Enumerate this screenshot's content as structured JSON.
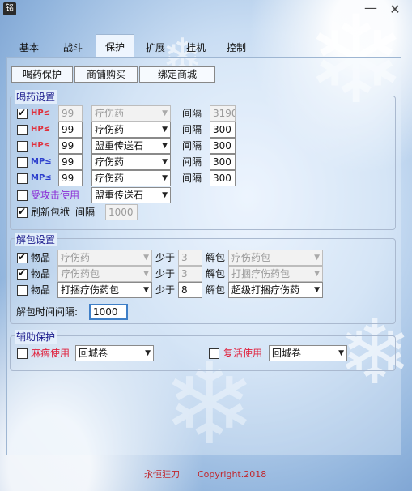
{
  "window": {
    "app_icon": "铭",
    "minimize_icon": "minimize-icon",
    "close_icon": "close-icon",
    "minimize_label": "—",
    "close_label": "✕"
  },
  "main_tabs": [
    "基本",
    "战斗",
    "保护",
    "扩展",
    "挂机",
    "控制"
  ],
  "active_main_tab": "保护",
  "sub_tabs": [
    "喝药保护",
    "商铺购买",
    "绑定商城"
  ],
  "potion_group": {
    "title": "喝药设置",
    "interval_label": "间隔",
    "rows": [
      {
        "checked": true,
        "tag": "HP≤",
        "percent": "99",
        "item": "疗伤药",
        "interval": "3190",
        "enabled": false
      },
      {
        "checked": false,
        "tag": "HP≤",
        "percent": "99",
        "item": "疗伤药",
        "interval": "300",
        "enabled": true
      },
      {
        "checked": false,
        "tag": "HP≤",
        "percent": "99",
        "item": "盟重传送石",
        "interval": "300",
        "enabled": true
      },
      {
        "checked": false,
        "tag": "MP≤",
        "percent": "99",
        "item": "疗伤药",
        "interval": "300",
        "enabled": true
      },
      {
        "checked": false,
        "tag": "MP≤",
        "percent": "99",
        "item": "疗伤药",
        "interval": "300",
        "enabled": true
      }
    ],
    "attacked": {
      "checked": false,
      "label": "受攻击使用",
      "item": "盟重传送石"
    },
    "refresh": {
      "checked": true,
      "label": "刷新包袱",
      "interval_label": "间隔",
      "value": "1000"
    }
  },
  "unpack_group": {
    "title": "解包设置",
    "item_label": "物品",
    "less_label": "少于",
    "unpack_label": "解包",
    "rows": [
      {
        "checked": true,
        "item": "疗伤药",
        "less": "3",
        "unpack": "疗伤药包",
        "enabled": false
      },
      {
        "checked": true,
        "item": "疗伤药包",
        "less": "3",
        "unpack": "打捆疗伤药包",
        "enabled": false
      },
      {
        "checked": false,
        "item": "打捆疗伤药包",
        "less": "8",
        "unpack": "超级打捆疗伤药",
        "enabled": true
      }
    ],
    "time_label": "解包时间间隔:",
    "time_value": "1000"
  },
  "assist_group": {
    "title": "辅助保护",
    "paralysis": {
      "checked": false,
      "label": "麻痹使用",
      "item": "回城卷"
    },
    "revive": {
      "checked": false,
      "label": "复活使用",
      "item": "回城卷"
    }
  },
  "footer": {
    "author": "永恒狂刀",
    "copyright": "Copyright.2018"
  },
  "colors": {
    "hp": "#e0303c",
    "mp": "#2a3ccc",
    "accent": "#3f7fc7"
  }
}
